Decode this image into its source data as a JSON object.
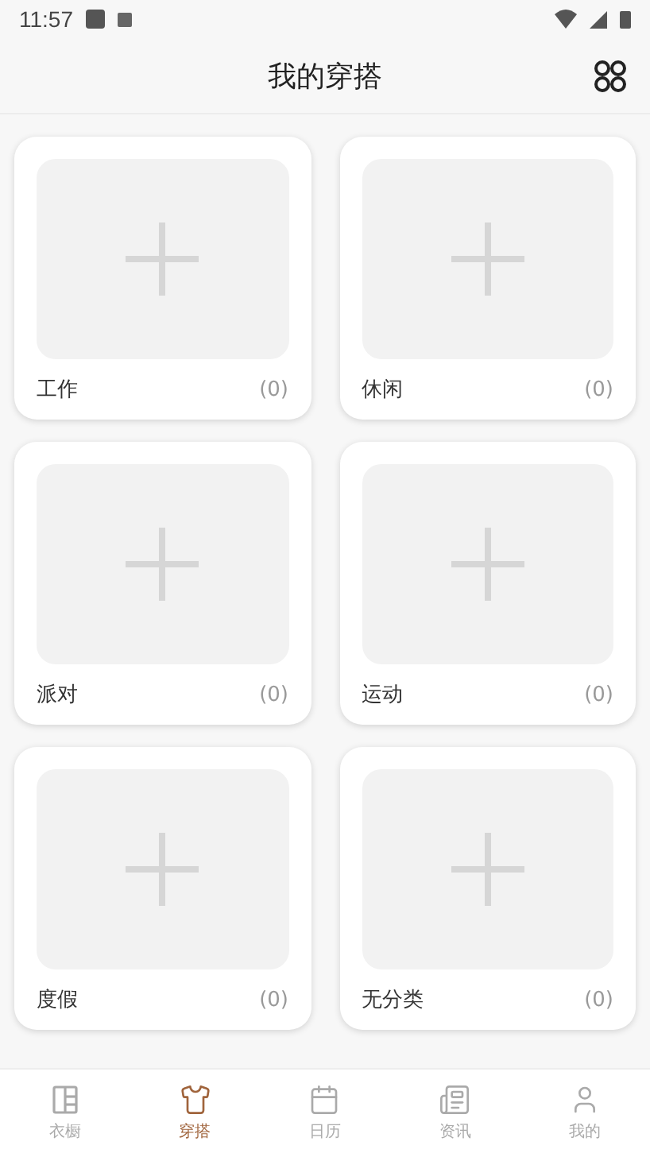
{
  "status_bar": {
    "time": "11:57"
  },
  "header": {
    "title": "我的穿搭"
  },
  "outfits": [
    {
      "name": "工作",
      "count": "(0)"
    },
    {
      "name": "休闲",
      "count": "(0)"
    },
    {
      "name": "派对",
      "count": "(0)"
    },
    {
      "name": "运动",
      "count": "(0)"
    },
    {
      "name": "度假",
      "count": "(0)"
    },
    {
      "name": "无分类",
      "count": "(0)"
    }
  ],
  "nav": [
    {
      "label": "衣橱",
      "kind": "wardrobe",
      "selected": false
    },
    {
      "label": "穿搭",
      "kind": "shirt",
      "selected": true
    },
    {
      "label": "日历",
      "kind": "calendar",
      "selected": false
    },
    {
      "label": "资讯",
      "kind": "news",
      "selected": false
    },
    {
      "label": "我的",
      "kind": "user",
      "selected": false
    }
  ]
}
